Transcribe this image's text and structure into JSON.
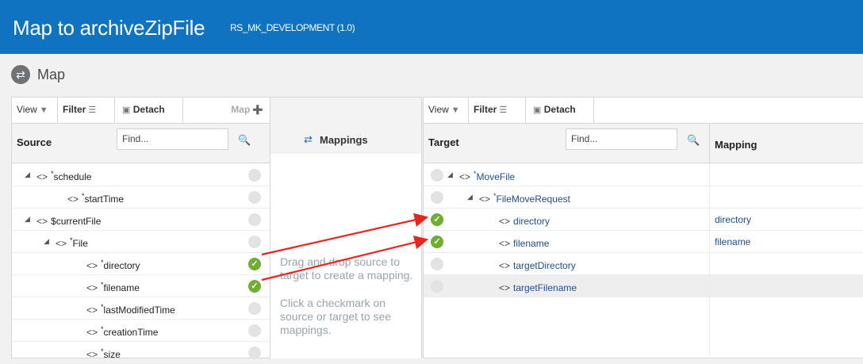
{
  "header": {
    "title": "Map to archiveZipFile",
    "subtitle": "RS_MK_DEVELOPMENT (1.0)"
  },
  "mapbar": {
    "label": "Map",
    "icon": "map-back-icon"
  },
  "source": {
    "toolbar": {
      "view": "View",
      "filter": "Filter",
      "detach": "Detach",
      "map": "Map"
    },
    "column": "Source",
    "find_placeholder": "Find...",
    "rows": [
      {
        "label": "schedule",
        "required": "*",
        "checked": false
      },
      {
        "label": "startTime",
        "required": "*",
        "checked": false
      },
      {
        "label": "$currentFile",
        "required": "",
        "checked": false
      },
      {
        "label": "File",
        "required": "*",
        "checked": false
      },
      {
        "label": "directory",
        "required": "*",
        "checked": true
      },
      {
        "label": "filename",
        "required": "*",
        "checked": true
      },
      {
        "label": "lastModifiedTime",
        "required": "*",
        "checked": false
      },
      {
        "label": "creationTime",
        "required": "*",
        "checked": false
      },
      {
        "label": "size",
        "required": "*",
        "checked": false
      }
    ]
  },
  "middle": {
    "title": "Mappings",
    "hint1": "Drag and drop source to target to create a mapping.",
    "hint2": "Click a checkmark on source or target to see mappings."
  },
  "target": {
    "toolbar": {
      "view": "View",
      "filter": "Filter",
      "detach": "Detach"
    },
    "column": "Target",
    "mapping_column": "Mapping",
    "find_placeholder": "Find...",
    "rows": [
      {
        "label": "MoveFile",
        "required": "*",
        "checked": false,
        "mapping": ""
      },
      {
        "label": "FileMoveRequest",
        "required": "*",
        "checked": false,
        "mapping": ""
      },
      {
        "label": "directory",
        "required": "",
        "checked": true,
        "mapping": "directory"
      },
      {
        "label": "filename",
        "required": "",
        "checked": true,
        "mapping": "filename"
      },
      {
        "label": "targetDirectory",
        "required": "",
        "checked": false,
        "mapping": ""
      },
      {
        "label": "targetFilename",
        "required": "",
        "checked": false,
        "mapping": ""
      }
    ]
  },
  "colors": {
    "header": "#0f73c2",
    "check": "#6fae2e",
    "arrow": "#e8261f",
    "link": "#1d4e9c"
  }
}
